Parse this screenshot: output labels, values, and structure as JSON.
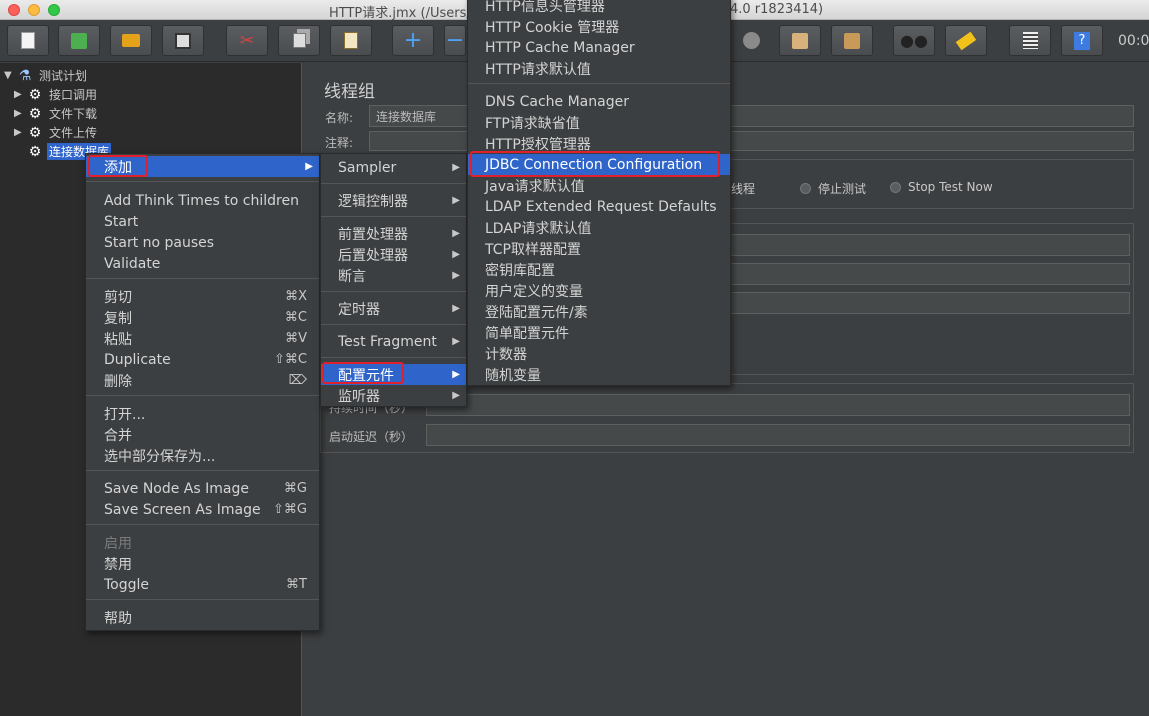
{
  "window": {
    "title": "HTTP请求.jmx (/Users/",
    "title_suffix": "4.0 r1823414)"
  },
  "toolbar": {
    "time_text": "00:0",
    "buttons": [
      {
        "name": "new",
        "icon": "new-document-icon"
      },
      {
        "name": "templates",
        "icon": "templates-icon"
      },
      {
        "name": "open",
        "icon": "open-folder-icon"
      },
      {
        "name": "save",
        "icon": "save-icon"
      },
      {
        "name": "cut",
        "icon": "scissors-icon"
      },
      {
        "name": "copy",
        "icon": "copy-icon"
      },
      {
        "name": "paste",
        "icon": "paste-icon"
      },
      {
        "name": "expand",
        "icon": "plus-icon"
      },
      {
        "name": "collapse",
        "icon": "minus-icon"
      },
      {
        "name": "stop",
        "icon": "stop-icon"
      },
      {
        "name": "clear",
        "icon": "broom-icon"
      },
      {
        "name": "clear-all",
        "icon": "broom-all-icon"
      },
      {
        "name": "search",
        "icon": "binoculars-icon"
      },
      {
        "name": "reset-search",
        "icon": "brush-icon"
      },
      {
        "name": "function-helper",
        "icon": "list-icon"
      },
      {
        "name": "help",
        "icon": "help-icon"
      }
    ]
  },
  "tree": {
    "items": [
      {
        "label": "测试计划",
        "arrow": "▼",
        "icon": "flask-icon"
      },
      {
        "label": "接口调用",
        "arrow": "▶",
        "icon": "gear-icon"
      },
      {
        "label": "文件下载",
        "arrow": "▶",
        "icon": "gear-icon"
      },
      {
        "label": "文件上传",
        "arrow": "▶",
        "icon": "gear-icon"
      },
      {
        "label": "连接数据库",
        "arrow": "",
        "icon": "gear-icon"
      }
    ]
  },
  "panel": {
    "title": "线程组",
    "name_label": "名称:",
    "name_value": "连接数据库",
    "comment_label": "注释:",
    "radio_stop_thread": "停止线程",
    "radio_stop_test": "停止测试",
    "radio_stop_test_now": "Stop Test Now",
    "duration_label": "持续时间（秒）",
    "startup_delay_label": "启动延迟（秒）"
  },
  "context_menu": {
    "add": "添加",
    "add_think_times": "Add Think Times to children",
    "start": "Start",
    "start_no_pauses": "Start no pauses",
    "validate": "Validate",
    "cut": "剪切",
    "cut_sc": "⌘X",
    "copy": "复制",
    "copy_sc": "⌘C",
    "paste": "粘贴",
    "paste_sc": "⌘V",
    "duplicate": "Duplicate",
    "duplicate_sc": "⇧⌘C",
    "delete": "删除",
    "delete_sc": "⌦",
    "open": "打开...",
    "merge": "合并",
    "save_selection": "选中部分保存为...",
    "save_node_image": "Save Node As Image",
    "save_node_image_sc": "⌘G",
    "save_screen_image": "Save Screen As Image",
    "save_screen_image_sc": "⇧⌘G",
    "enable": "启用",
    "disable": "禁用",
    "toggle": "Toggle",
    "toggle_sc": "⌘T",
    "help": "帮助"
  },
  "add_menu": {
    "sampler": "Sampler",
    "logic_controller": "逻辑控制器",
    "pre_processor": "前置处理器",
    "post_processor": "后置处理器",
    "assertion": "断言",
    "timer": "定时器",
    "test_fragment": "Test Fragment",
    "config_element": "配置元件",
    "listener": "监听器"
  },
  "config_menu": {
    "items": [
      "HTTP信息头管理器",
      "HTTP Cookie 管理器",
      "HTTP Cache Manager",
      "HTTP请求默认值",
      "DNS Cache Manager",
      "FTP请求缺省值",
      "HTTP授权管理器",
      "JDBC Connection Configuration",
      "Java请求默认值",
      "LDAP Extended Request Defaults",
      "LDAP请求默认值",
      "TCP取样器配置",
      "密钥库配置",
      "用户定义的变量",
      "登陆配置元件/素",
      "简单配置元件",
      "计数器",
      "随机变量"
    ]
  },
  "colors": {
    "highlight": "#2f65ca",
    "annotation_red": "#e0202c",
    "background": "#3c3f41"
  }
}
